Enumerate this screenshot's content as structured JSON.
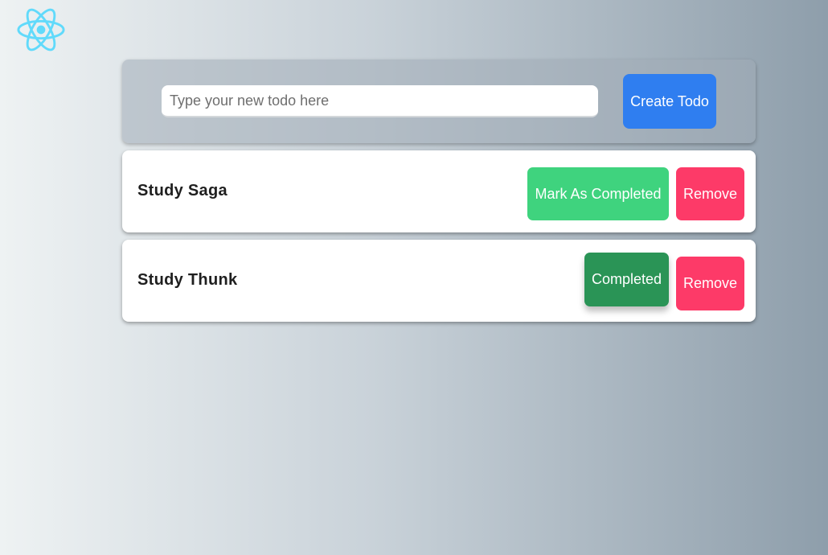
{
  "logo": {
    "icon": "react-atom-icon",
    "color": "#61dafb"
  },
  "new_todo": {
    "placeholder": "Type your new todo here",
    "value": "",
    "create_label": "Create Todo"
  },
  "todos": [
    {
      "title": "Study Saga",
      "status": "pending",
      "action_label": "Mark As Completed",
      "remove_label": "Remove"
    },
    {
      "title": "Study Thunk",
      "status": "completed",
      "action_label": "Completed",
      "remove_label": "Remove"
    }
  ],
  "colors": {
    "create_button": "#2f7ef0",
    "mark_button": "#3fd37e",
    "completed_button": "#2a9456",
    "remove_button": "#fd3a68"
  }
}
